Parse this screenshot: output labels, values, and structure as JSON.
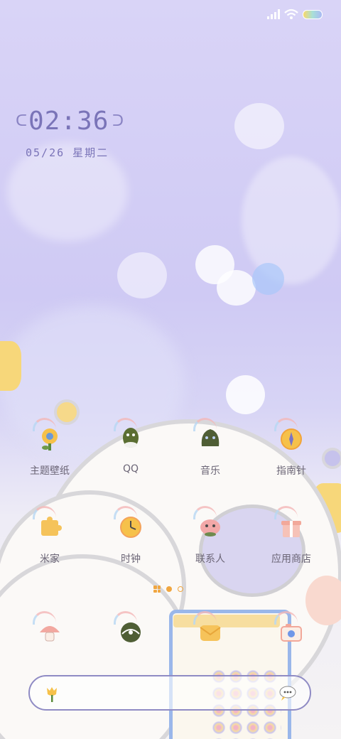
{
  "status_bar": {
    "signal_icon": "cellular-signal-icon",
    "wifi_icon": "wifi-icon",
    "battery_icon": "battery-icon"
  },
  "clock": {
    "time": "02:36",
    "date": "05/26  星期二"
  },
  "apps_row1": [
    {
      "label": "主题壁纸",
      "icon": "theme-flower-icon"
    },
    {
      "label": "QQ",
      "icon": "qq-icon"
    },
    {
      "label": "音乐",
      "icon": "music-icon"
    },
    {
      "label": "指南针",
      "icon": "compass-icon"
    }
  ],
  "apps_row2": [
    {
      "label": "米家",
      "icon": "mi-home-puzzle-icon"
    },
    {
      "label": "时钟",
      "icon": "clock-app-icon"
    },
    {
      "label": "联系人",
      "icon": "contacts-icon"
    },
    {
      "label": "应用商店",
      "icon": "app-store-gift-icon"
    }
  ],
  "dock": [
    {
      "icon": "phone-mushroom-icon"
    },
    {
      "icon": "browser-icon"
    },
    {
      "icon": "messages-icon"
    },
    {
      "icon": "camera-icon"
    }
  ],
  "page_indicator": {
    "pages": 3,
    "current": 1
  },
  "search_bar": {
    "left_icon": "tulip-icon",
    "right_icon": "voice-assistant-icon"
  },
  "colors": {
    "accent": "#7a74b8",
    "search_border": "#8f8bc4",
    "active_dot": "#f0a640"
  }
}
